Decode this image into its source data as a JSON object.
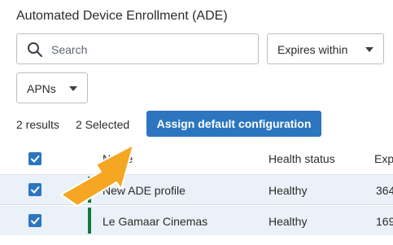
{
  "page": {
    "title": "Automated Device Enrollment (ADE)"
  },
  "search": {
    "placeholder": "Search",
    "value": ""
  },
  "filters": {
    "expires": "Expires within",
    "apns": "APNs"
  },
  "summary": {
    "results": "2 results",
    "selected": "2 Selected"
  },
  "actions": {
    "assign": "Assign default configuration"
  },
  "table": {
    "columns": [
      "Name",
      "Health status",
      "Exp"
    ],
    "rows": [
      {
        "name": "New ADE profile",
        "health": "Healthy",
        "expires": "364",
        "selected": true
      },
      {
        "name": "Le Gamaar Cinemas",
        "health": "Healthy",
        "expires": "169",
        "selected": true
      }
    ]
  },
  "colors": {
    "accent": "#2c76bf",
    "status_stripe": "#0d7a3e",
    "selected_row": "#eaf1f8",
    "annotation_arrow": "#f5a623"
  },
  "icons": {
    "search": "search-icon",
    "dropdown": "chevron-down-icon",
    "check": "checkmark-icon"
  }
}
